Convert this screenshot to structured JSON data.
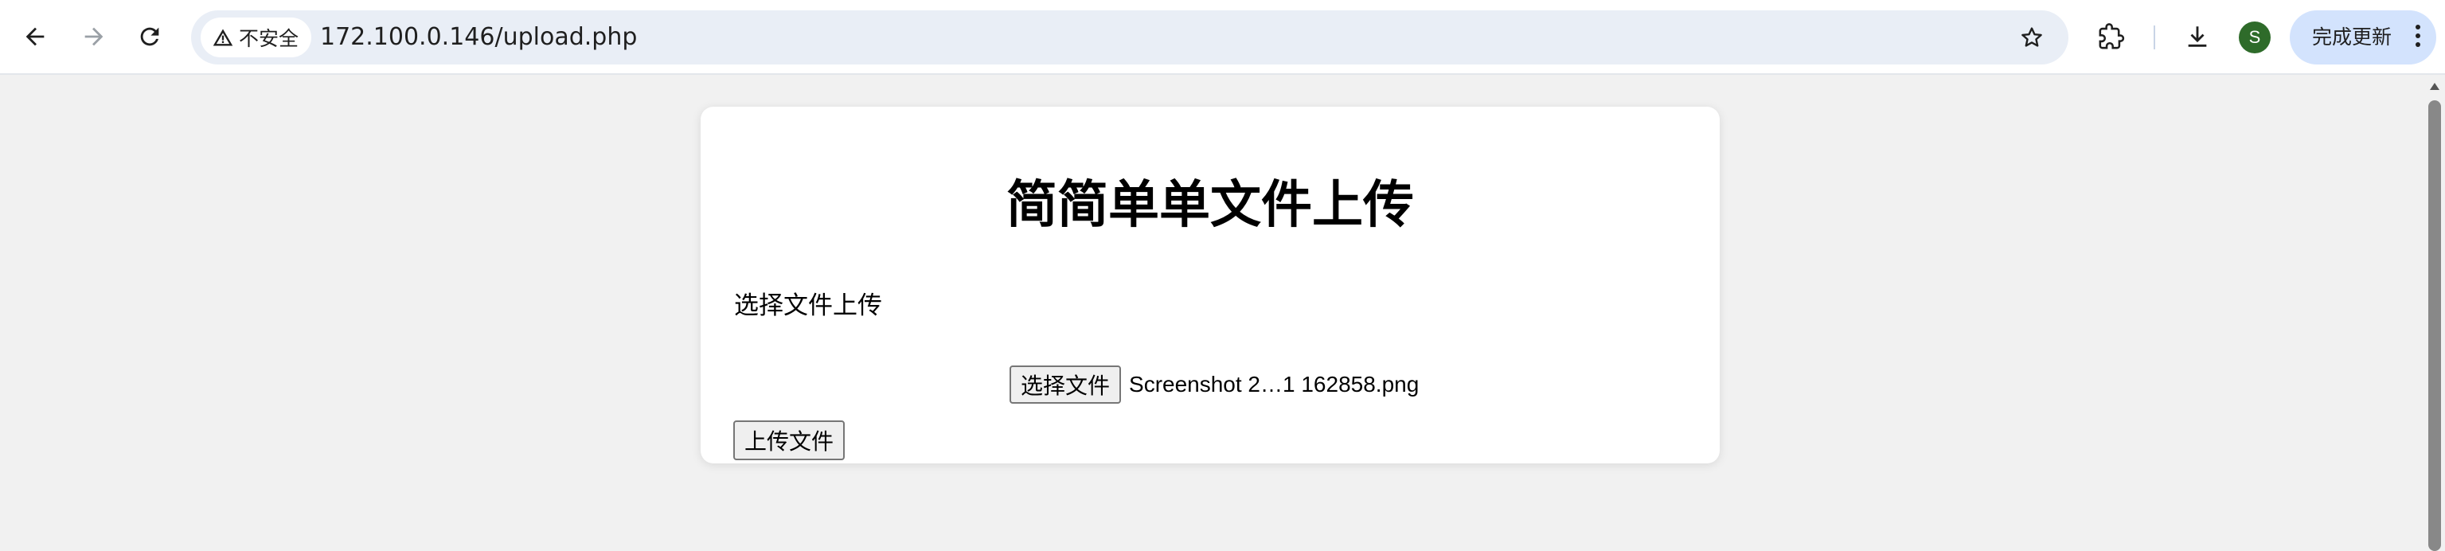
{
  "browser": {
    "security_label": "不安全",
    "url": "172.100.0.146/upload.php",
    "profile_initial": "S",
    "update_label": "完成更新",
    "icons": {
      "back": "arrow-back-icon",
      "forward": "arrow-forward-icon",
      "reload": "reload-icon",
      "warning": "warning-icon",
      "bookmark": "star-icon",
      "extensions": "puzzle-icon",
      "downloads": "download-icon",
      "menu": "kebab-menu-icon"
    },
    "colors": {
      "omnibox_bg": "#e9eef6",
      "avatar_bg": "#2e6b2a",
      "update_bg": "#d3e3fd",
      "page_bg": "#f1f1f1"
    }
  },
  "page": {
    "title": "简简单单文件上传",
    "file_label": "选择文件上传",
    "choose_button": "选择文件",
    "selected_file": "Screenshot 2…1 162858.png",
    "upload_button": "上传文件"
  }
}
